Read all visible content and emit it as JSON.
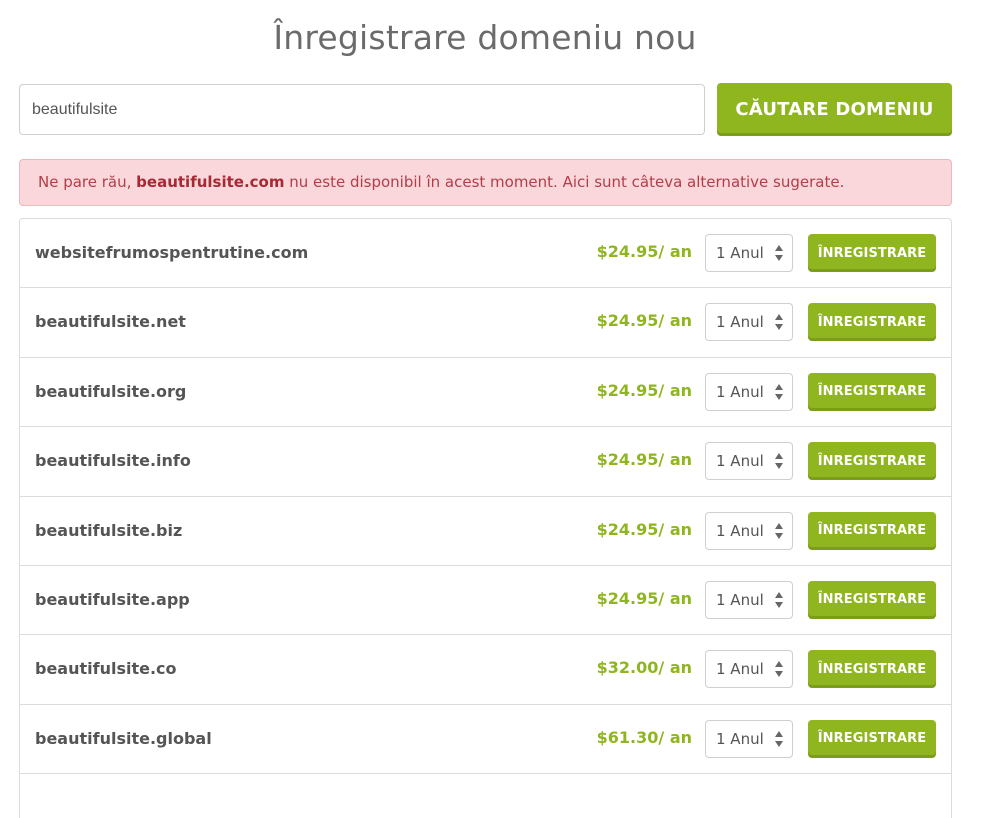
{
  "page": {
    "title": "Înregistrare domeniu nou"
  },
  "search": {
    "value": "beautifulsite",
    "button_label": "CĂUTARE DOMENIU"
  },
  "alert": {
    "prefix": "Ne pare rău, ",
    "domain": "beautifulsite.com",
    "suffix": " nu este disponibil în acest moment. Aici sunt câteva alternative sugerate."
  },
  "colors": {
    "accent": "#8fb51f",
    "alert_background": "#f9d7da",
    "alert_text": "#b33e4a"
  },
  "suggestions": [
    {
      "domain": "websitefrumospentrutine.com",
      "price": "$24.95/ an",
      "period": "1 Anul",
      "button": "ÎNREGISTRARE"
    },
    {
      "domain": "beautifulsite.net",
      "price": "$24.95/ an",
      "period": "1 Anul",
      "button": "ÎNREGISTRARE"
    },
    {
      "domain": "beautifulsite.org",
      "price": "$24.95/ an",
      "period": "1 Anul",
      "button": "ÎNREGISTRARE"
    },
    {
      "domain": "beautifulsite.info",
      "price": "$24.95/ an",
      "period": "1 Anul",
      "button": "ÎNREGISTRARE"
    },
    {
      "domain": "beautifulsite.biz",
      "price": "$24.95/ an",
      "period": "1 Anul",
      "button": "ÎNREGISTRARE"
    },
    {
      "domain": "beautifulsite.app",
      "price": "$24.95/ an",
      "period": "1 Anul",
      "button": "ÎNREGISTRARE"
    },
    {
      "domain": "beautifulsite.co",
      "price": "$32.00/ an",
      "period": "1 Anul",
      "button": "ÎNREGISTRARE"
    },
    {
      "domain": "beautifulsite.global",
      "price": "$61.30/ an",
      "period": "1 Anul",
      "button": "ÎNREGISTRARE"
    }
  ]
}
